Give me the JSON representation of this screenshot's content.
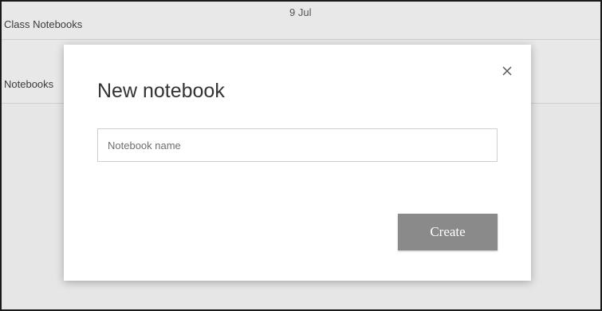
{
  "background": {
    "list_items": [
      "Class Notebooks",
      "Notebooks"
    ],
    "date": "9 Jul"
  },
  "dialog": {
    "title": "New notebook",
    "close_icon": "close-icon",
    "name_input": {
      "value": "",
      "placeholder": "Notebook name"
    },
    "create_label": "Create"
  },
  "colors": {
    "create_button_bg": "#8a8a8a",
    "backdrop": "#e6e6e6",
    "dialog_bg": "#ffffff"
  }
}
